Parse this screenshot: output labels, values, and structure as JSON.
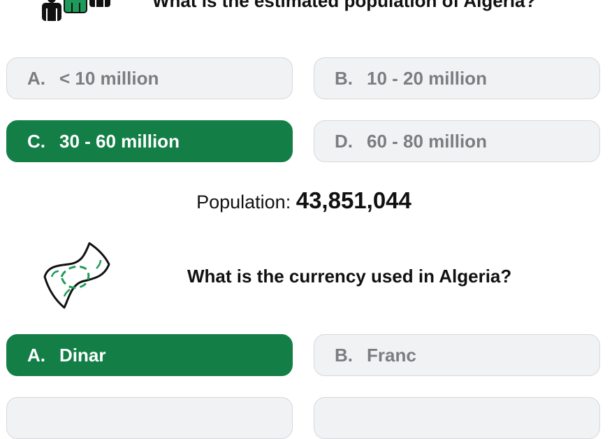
{
  "question1": {
    "title": "What is the estimated population of Algeria?",
    "icon": "people-icon",
    "options": [
      {
        "letter": "A.",
        "label": "< 10 million",
        "selected": false
      },
      {
        "letter": "B.",
        "label": "10 - 20 million",
        "selected": false
      },
      {
        "letter": "C.",
        "label": "30 - 60 million",
        "selected": true
      },
      {
        "letter": "D.",
        "label": "60 - 80 million",
        "selected": false
      }
    ],
    "answer": {
      "label": "Population:",
      "value": "43,851,044"
    }
  },
  "question2": {
    "title": "What is the currency used in Algeria?",
    "icon": "banknote-icon",
    "options": [
      {
        "letter": "A.",
        "label": "Dinar",
        "selected": true
      },
      {
        "letter": "B.",
        "label": "Franc",
        "selected": false
      }
    ]
  },
  "colors": {
    "selected": "#137f47",
    "option_bg": "#f1f2f4",
    "option_text": "#7b7d80",
    "icon_green": "#1e9b5a"
  }
}
